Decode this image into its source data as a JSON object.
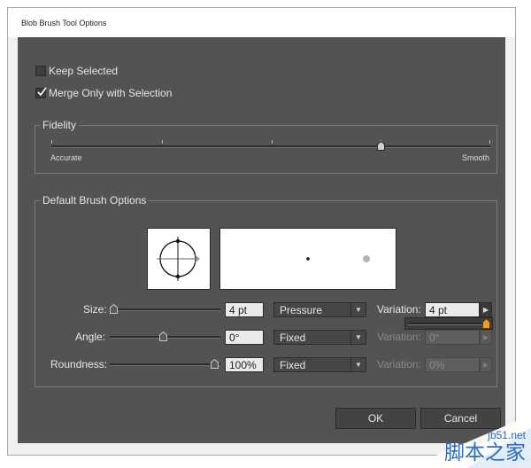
{
  "dialog": {
    "title": "Blob Brush Tool Options"
  },
  "options": {
    "keep_selected": {
      "label": "Keep Selected",
      "checked": false
    },
    "merge_only": {
      "label": "Merge Only with Selection",
      "checked": true
    }
  },
  "fidelity": {
    "legend": "Fidelity",
    "left_label": "Accurate",
    "right_label": "Smooth",
    "value": 0.75
  },
  "brush": {
    "legend": "Default Brush Options",
    "size": {
      "label": "Size:",
      "value": "4 pt",
      "method": "Pressure",
      "variation_label": "Variation:",
      "variation": "4 pt",
      "variation_enabled": true
    },
    "angle": {
      "label": "Angle:",
      "value": "0°",
      "method": "Fixed",
      "variation_label": "Variation:",
      "variation": "0°",
      "variation_enabled": false
    },
    "roundness": {
      "label": "Roundness:",
      "value": "100%",
      "method": "Fixed",
      "variation_label": "Variation:",
      "variation": "0%",
      "variation_enabled": false
    }
  },
  "buttons": {
    "ok": "OK",
    "cancel": "Cancel"
  },
  "watermark": {
    "site": "jb51.net",
    "text": "脚本之家"
  }
}
